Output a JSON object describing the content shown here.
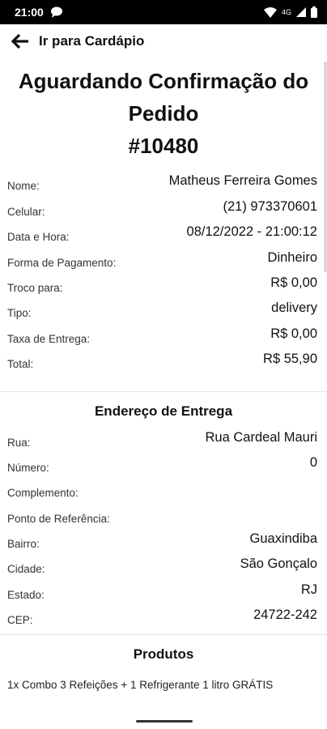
{
  "status_bar": {
    "time": "21:00",
    "network_label": "4G"
  },
  "topbar": {
    "back_label": "Ir para Cardápio"
  },
  "order": {
    "status_title": "Aguardando Confirmação do Pedido",
    "number": "#10480"
  },
  "details": [
    {
      "label": "Nome:",
      "value": "Matheus Ferreira Gomes"
    },
    {
      "label": "Celular:",
      "value": "(21) 973370601"
    },
    {
      "label": "Data e Hora:",
      "value": "08/12/2022 - 21:00:12"
    },
    {
      "label": "Forma de Pagamento:",
      "value": "Dinheiro"
    },
    {
      "label": "Troco para:",
      "value": "R$ 0,00"
    },
    {
      "label": "Tipo:",
      "value": "delivery"
    },
    {
      "label": "Taxa de Entrega:",
      "value": "R$ 0,00"
    },
    {
      "label": "Total:",
      "value": "R$ 55,90"
    }
  ],
  "address": {
    "title": "Endereço de Entrega",
    "fields": [
      {
        "label": "Rua:",
        "value": "Rua Cardeal Mauri"
      },
      {
        "label": "Número:",
        "value": "0"
      },
      {
        "label": "Complemento:",
        "value": ""
      },
      {
        "label": "Ponto de Referência:",
        "value": ""
      },
      {
        "label": "Bairro:",
        "value": "Guaxindiba"
      },
      {
        "label": "Cidade:",
        "value": "São Gonçalo"
      },
      {
        "label": "Estado:",
        "value": "RJ"
      },
      {
        "label": "CEP:",
        "value": "24722-242"
      }
    ]
  },
  "products": {
    "title": "Produtos",
    "items": [
      "1x Combo 3 Refeições + 1 Refrigerante 1 litro GRÁTIS"
    ]
  },
  "icons": {
    "back": "arrow-left-icon",
    "chat": "chat-bubble-icon",
    "wifi": "wifi-icon",
    "signal": "signal-icon",
    "battery": "battery-icon"
  }
}
